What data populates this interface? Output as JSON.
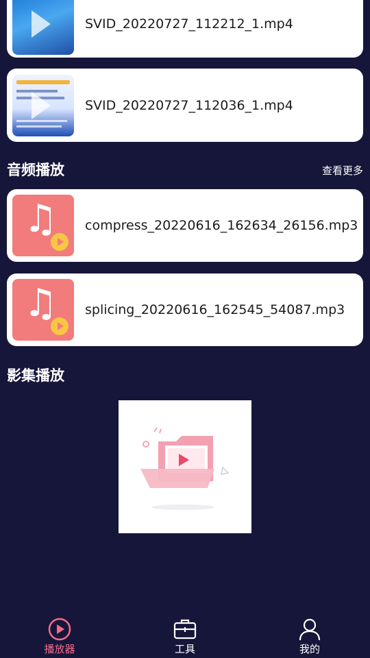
{
  "videos": [
    {
      "name": "SVID_20220727_112212_1.mp4",
      "thumb_icon": "play-icon"
    },
    {
      "name": "SVID_20220727_112036_1.mp4",
      "thumb_icon": "play-icon"
    }
  ],
  "audio_section": {
    "title": "音频播放",
    "more_label": "查看更多",
    "items": [
      {
        "name": "compress_20220616_162634_26156.mp3",
        "icon": "music-note-icon"
      },
      {
        "name": "splicing_20220616_162545_54087.mp3",
        "icon": "music-note-icon"
      }
    ]
  },
  "album_section": {
    "title": "影集播放",
    "empty_icon": "empty-folder-video-icon"
  },
  "tabbar": {
    "tabs": [
      {
        "label": "播放器",
        "icon": "player-icon",
        "active": true
      },
      {
        "label": "工具",
        "icon": "toolbox-icon",
        "active": false
      },
      {
        "label": "我的",
        "icon": "user-icon",
        "active": false
      }
    ]
  },
  "colors": {
    "background": "#16163a",
    "card": "#ffffff",
    "audio_thumb": "#f27b7b",
    "mini_play": "#f7c744",
    "active_tab": "#f46c8a",
    "inactive_tab": "#ffffff"
  }
}
